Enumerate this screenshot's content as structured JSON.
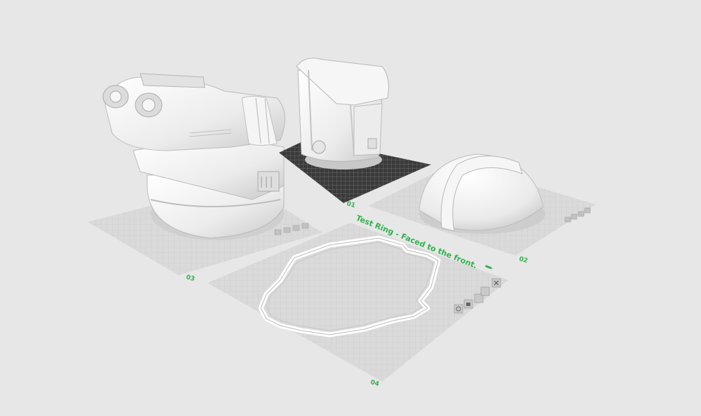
{
  "plates": [
    {
      "id": "plate-03",
      "number": "03"
    },
    {
      "id": "plate-01",
      "number": "01"
    },
    {
      "id": "plate-02",
      "number": "02"
    },
    {
      "id": "plate-04",
      "number": "04",
      "title": "Test Ring - Faced to the front."
    }
  ],
  "icons": {
    "plate_tools": [
      "auto-arrange-icon",
      "orient-icon",
      "slice-icon",
      "settings-icon",
      "close-icon"
    ],
    "edit_title": "pencil-icon"
  },
  "colors": {
    "background": "#e7e7e7",
    "plate": "#d9d9d9",
    "grid": "#c6c6c6",
    "active_plate": "#3a3a3a",
    "accent": "#2fb34c",
    "model": "#f2f2f2"
  }
}
